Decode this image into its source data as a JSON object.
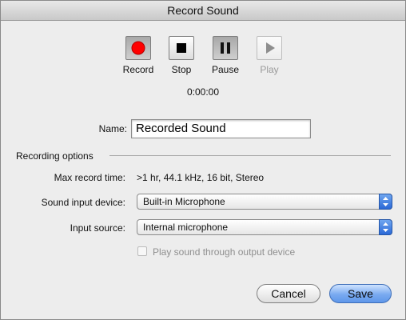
{
  "window": {
    "title": "Record Sound"
  },
  "transport": {
    "record_label": "Record",
    "stop_label": "Stop",
    "pause_label": "Pause",
    "play_label": "Play",
    "record_color": "#ff0000",
    "elapsed": "0:00:00"
  },
  "name": {
    "label": "Name:",
    "value": "Recorded Sound"
  },
  "options": {
    "section_title": "Recording options",
    "max_time_label": "Max record time:",
    "max_time_value": ">1 hr, 44.1 kHz, 16 bit, Stereo",
    "device_label": "Sound input device:",
    "device_value": "Built-in Microphone",
    "source_label": "Input source:",
    "source_value": "Internal microphone",
    "playthrough_label": "Play sound through output device",
    "playthrough_checked": false
  },
  "buttons": {
    "cancel": "Cancel",
    "save": "Save"
  }
}
